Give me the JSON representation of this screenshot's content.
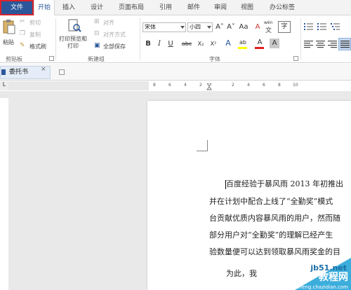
{
  "tabs": [
    "文件",
    "开始",
    "插入",
    "设计",
    "页面布局",
    "引用",
    "邮件",
    "审阅",
    "视图",
    "办公标签"
  ],
  "clipboard": {
    "paste": "粘贴",
    "cut": "剪切",
    "copy": "复制",
    "format_painter": "格式刷",
    "group_label": "剪贴板"
  },
  "newgroup": {
    "print_preview": "打印预览和",
    "print_preview_2": "打印",
    "align": "对齐",
    "align_style": "对齐方式",
    "save_all": "全部保存",
    "group_label": "新建组"
  },
  "font": {
    "family": "宋体",
    "size": "小四",
    "group_label": "字体",
    "bold": "B",
    "italic": "I",
    "underline": "U",
    "strike": "abc",
    "sub": "X₂",
    "sup": "X²",
    "grow": "A˄",
    "shrink": "A˅",
    "case": "Aa",
    "clear": "A",
    "wen": "wén",
    "wen_char": "文",
    "effects": "A",
    "highlight": "ab",
    "color": "A",
    "shading": "A",
    "border_char": "字"
  },
  "document": {
    "tab_title": "委托书",
    "tab_close": "×"
  },
  "ruler": {
    "corner": "L",
    "numbers": [
      "8",
      "6",
      "4",
      "2",
      "2",
      "4",
      "6",
      "8",
      "10"
    ]
  },
  "body": {
    "line1": "百度经验于暴风雨 2013 年初推出",
    "line2": "并在计划中配合上线了“全勤奖”模式",
    "line3": "台贡献优质内容暴风雨的用户，然而随",
    "line4": "部分用户对“全勤奖”的理解已经产生",
    "line5": "验数量便可以达到领取暴风雨奖金的目",
    "line6": "为此，我"
  },
  "watermark": {
    "site": "jb51.net",
    "cn": "教程网",
    "en": "jiaocheng.chazidian.com"
  },
  "colors": {
    "file_tab": "#2b579a",
    "highlight_box": "#d8232a",
    "font_color_bar": "#e02020",
    "highlight_bar": "#ffff00",
    "watermark": "#27a5d8"
  }
}
